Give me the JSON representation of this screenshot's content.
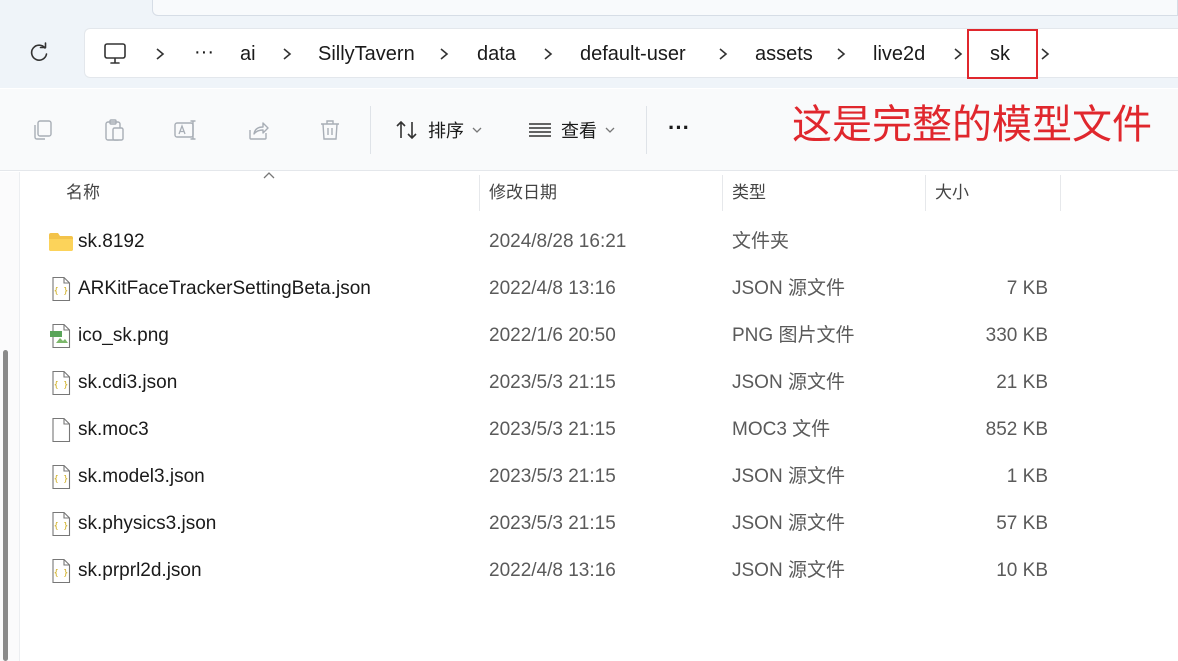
{
  "address_bar": {
    "crumbs": [
      "ai",
      "SillyTavern",
      "data",
      "default-user",
      "assets",
      "live2d",
      "sk"
    ],
    "overflow_label": "···",
    "icons": {
      "refresh": "refresh-icon",
      "computer": "computer-icon",
      "separator": "chevron-right-icon"
    }
  },
  "toolbar": {
    "sort_label": "排序",
    "view_label": "查看",
    "more_label": "···",
    "icons": [
      "copy-icon",
      "paste-icon",
      "rename-icon",
      "share-icon",
      "delete-icon",
      "sort-icon",
      "view-icon",
      "more-icon"
    ]
  },
  "annotation": {
    "text": "这是完整的模型文件",
    "color": "#e0272d"
  },
  "columns": {
    "name": "名称",
    "modified": "修改日期",
    "type": "类型",
    "size": "大小"
  },
  "files": [
    {
      "name": "sk.8192",
      "modified": "2024/8/28 16:21",
      "type": "文件夹",
      "size": "",
      "icon": "folder-icon"
    },
    {
      "name": "ARKitFaceTrackerSettingBeta.json",
      "modified": "2022/4/8 13:16",
      "type": "JSON 源文件",
      "size": "7 KB",
      "icon": "json-file-icon"
    },
    {
      "name": "ico_sk.png",
      "modified": "2022/1/6 20:50",
      "type": "PNG 图片文件",
      "size": "330 KB",
      "icon": "png-file-icon"
    },
    {
      "name": "sk.cdi3.json",
      "modified": "2023/5/3 21:15",
      "type": "JSON 源文件",
      "size": "21 KB",
      "icon": "json-file-icon"
    },
    {
      "name": "sk.moc3",
      "modified": "2023/5/3 21:15",
      "type": "MOC3 文件",
      "size": "852 KB",
      "icon": "file-icon"
    },
    {
      "name": "sk.model3.json",
      "modified": "2023/5/3 21:15",
      "type": "JSON 源文件",
      "size": "1 KB",
      "icon": "json-file-icon"
    },
    {
      "name": "sk.physics3.json",
      "modified": "2023/5/3 21:15",
      "type": "JSON 源文件",
      "size": "57 KB",
      "icon": "json-file-icon"
    },
    {
      "name": "sk.prprl2d.json",
      "modified": "2022/4/8 13:16",
      "type": "JSON 源文件",
      "size": "10 KB",
      "icon": "json-file-icon"
    }
  ]
}
